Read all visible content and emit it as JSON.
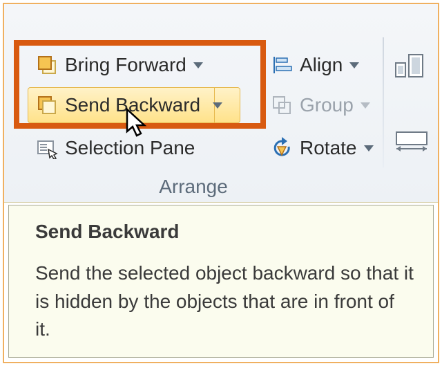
{
  "ribbon": {
    "group_label": "Arrange",
    "bring_forward": "Bring Forward",
    "send_backward": "Send Backward",
    "selection_pane": "Selection Pane",
    "align": "Align",
    "group": "Group",
    "rotate": "Rotate"
  },
  "tooltip": {
    "title": "Send Backward",
    "description": "Send the selected object backward so that it is hidden by the objects that are in front of it."
  }
}
